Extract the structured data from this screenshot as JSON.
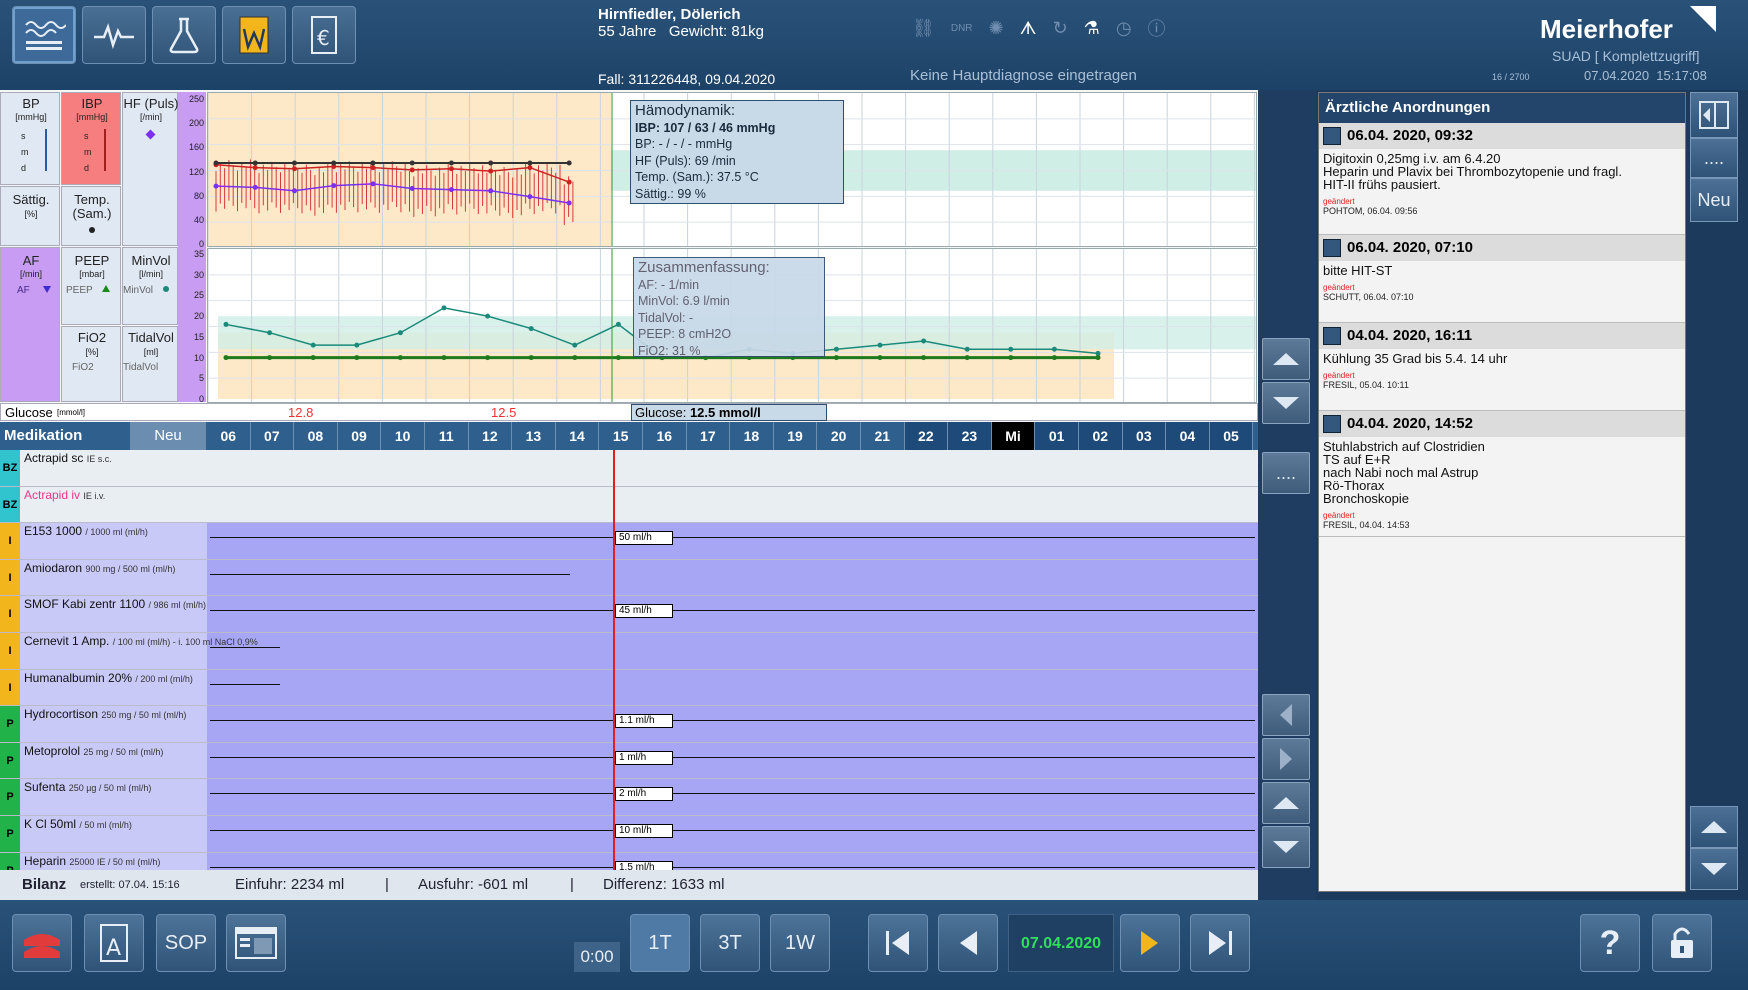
{
  "toolbar": {
    "icons": [
      "monitor-waves-icon",
      "vital-curve-icon",
      "flask-icon",
      "document-w-icon",
      "euro-document-icon"
    ]
  },
  "patient": {
    "name": "Hirnfiedler, Dölerich",
    "age_weight": "55 Jahre   Gewicht: 81kg",
    "case": "Fall: 311226448, 09.04.2020",
    "diagnosis": "Keine Hauptdiagnose eingetragen"
  },
  "header_icons": [
    "link-icon",
    "dnr-icon",
    "virus-icon",
    "lungs-icon",
    "refresh-icon",
    "lab-flask-icon",
    "clock-icon",
    "info-icon"
  ],
  "header_dnr": "DNR",
  "brand": {
    "name": "Meierhofer",
    "access": "SUAD [ Komplettzugriff]",
    "counter": "16 / 2700",
    "datetime": "07.04.2020  15:17:08"
  },
  "vitals_params": {
    "bp": {
      "label": "BP",
      "unit": "[mmHg]",
      "s": "s",
      "m": "m",
      "d": "d"
    },
    "ibp": {
      "label": "IBP",
      "unit": "[mmHg]",
      "s": "s",
      "m": "m",
      "d": "d"
    },
    "hf": {
      "label": "HF (Puls)",
      "unit": "[/min]"
    },
    "sattig": {
      "label": "Sättig.",
      "unit": "[%]"
    },
    "temp": {
      "label": "Temp.",
      "unit": "(Sam.)"
    },
    "af": {
      "label": "AF",
      "unit": "[/min]",
      "legend": "AF"
    },
    "peep": {
      "label": "PEEP",
      "unit": "[mbar]",
      "legend": "PEEP"
    },
    "minvol": {
      "label": "MinVol",
      "unit": "[l/min]",
      "legend": "MinVol"
    },
    "fio2": {
      "label": "FiO2",
      "unit": "[%]",
      "legend": "FiO2"
    },
    "tidalvol": {
      "label": "TidalVol",
      "unit": "[ml]",
      "legend": "TidalVol"
    }
  },
  "axis1": [
    "250",
    "200",
    "160",
    "120",
    "80",
    "40",
    "0"
  ],
  "axis2": [
    "35",
    "30",
    "25",
    "20",
    "15",
    "10",
    "5",
    "0"
  ],
  "hemodynamik": {
    "title": "Hämodynamik:",
    "ibp": "IBP: 107 / 63 / 46 mmHg",
    "bp": "BP: - / - / - mmHg",
    "hf": "HF (Puls): 69 /min",
    "temp": "Temp. (Sam.): 37.5 °C",
    "sattig": "Sättig.: 99 %"
  },
  "zusammenfassung": {
    "title": "Zusammenfassung:",
    "af": "AF: - 1/min",
    "minvol": "MinVol: 6.9 l/min",
    "tidalvol": "TidalVol: -",
    "peep": "PEEP: 8 cmH2O",
    "fio2": "FiO2: 31 %"
  },
  "glucose": {
    "label": "Glucose",
    "unit": "[mmol/l]",
    "v1": "12.8",
    "v2": "12.5",
    "current_label": "Glucose:",
    "current_value": "12.5 mmol/l"
  },
  "medikation": {
    "label": "Medikation",
    "neu": "Neu",
    "hours": [
      "06",
      "07",
      "08",
      "09",
      "10",
      "11",
      "12",
      "13",
      "14",
      "15",
      "16",
      "17",
      "18",
      "19",
      "20",
      "21",
      "22",
      "23",
      "Mi",
      "01",
      "02",
      "03",
      "04",
      "05"
    ],
    "rows": [
      {
        "cat": "BZ",
        "name": "Actrapid sc",
        "detail": "IE s.c."
      },
      {
        "cat": "BZ",
        "name": "Actrapid iv",
        "detail": "IE i.v."
      },
      {
        "cat": "I",
        "name": "E153 1000",
        "detail": "/ 1000 ml (ml/h)",
        "rate": "50 ml/h"
      },
      {
        "cat": "I",
        "name": "Amiodaron",
        "detail": "900 mg / 500 ml (ml/h)"
      },
      {
        "cat": "I",
        "name": "SMOF Kabi zentr 1100",
        "detail": "/ 986 ml (ml/h)",
        "rate": "45 ml/h"
      },
      {
        "cat": "I",
        "name": "Cernevit 1 Amp.",
        "detail": "/ 100 ml (ml/h) - i. 100 ml NaCl 0,9%"
      },
      {
        "cat": "I",
        "name": "Humanalbumin 20%",
        "detail": "/ 200 ml (ml/h)"
      },
      {
        "cat": "P",
        "name": "Hydrocortison",
        "detail": "250 mg / 50 ml (ml/h)",
        "rate": "1.1 ml/h"
      },
      {
        "cat": "P",
        "name": "Metoprolol",
        "detail": "25 mg / 50 ml (ml/h)",
        "rate": "1 ml/h"
      },
      {
        "cat": "P",
        "name": "Sufenta",
        "detail": "250 µg / 50 ml (ml/h)",
        "rate": "2 ml/h"
      },
      {
        "cat": "P",
        "name": "K Cl 50ml",
        "detail": "/ 50 ml (ml/h)",
        "rate": "10 ml/h"
      },
      {
        "cat": "P",
        "name": "Heparin",
        "detail": "25000 IE / 50 ml (ml/h)",
        "rate": "1.5 ml/h"
      }
    ]
  },
  "bilanz": {
    "label": "Bilanz",
    "created": "erstellt: 07.04. 15:16",
    "einfuhr": "Einfuhr: 2234 ml",
    "ausfuhr": "Ausfuhr: -601 ml",
    "differenz": "Differenz: 1633 ml",
    "sep": "|"
  },
  "side": {
    "more": "....",
    "neu": "Neu"
  },
  "orders": {
    "title": "Ärztliche Anordnungen",
    "items": [
      {
        "date": "06.04. 2020, 09:32",
        "text": "Digitoxin 0,25mg i.v. am 6.4.20\nHeparin und Plavix bei Thrombozytopenie und fragl.\nHIT-II frühs pausiert.",
        "changed": "geändert",
        "by": "POHTOM, 06.04. 09:56"
      },
      {
        "date": "06.04. 2020, 07:10",
        "text": "bitte HIT-ST",
        "changed": "geändert",
        "by": "SCHUTT, 06.04. 07:10"
      },
      {
        "date": "04.04. 2020, 16:11",
        "text": "Kühlung 35 Grad bis 5.4. 14 uhr",
        "changed": "geändert",
        "by": "FRESIL, 05.04. 10:11"
      },
      {
        "date": "04.04. 2020, 14:52",
        "text": "Stuhlabstrich auf Clostridien\nTS auf E+R\nnach Nabi noch mal Astrup\nRö-Thorax\nBronchoskopie",
        "changed": "geändert",
        "by": "FRESIL, 04.04. 14:53"
      }
    ]
  },
  "bottom": {
    "sop": "SOP",
    "time": "0:00",
    "t1": "1T",
    "t3": "3T",
    "w1": "1W",
    "date": "07.04.2020"
  },
  "colors": {
    "accent_yellow": "#f2b61c",
    "bp_pink": "#f77e7e",
    "resp_purple": "#c79cf2",
    "infusion": "#a6a6f5",
    "green_date": "#2ee05a"
  },
  "chart_data": [
    {
      "type": "line",
      "title": "",
      "x": [
        "06",
        "07",
        "08",
        "09",
        "10",
        "11",
        "12",
        "13",
        "14",
        "15"
      ],
      "ylim": [
        0,
        250
      ],
      "series": [
        {
          "name": "IBP",
          "values": [
            135,
            130,
            128,
            132,
            130,
            126,
            128,
            124,
            130,
            105
          ]
        },
        {
          "name": "HF (Puls)",
          "values": [
            98,
            96,
            90,
            99,
            102,
            94,
            92,
            90,
            80,
            69
          ]
        },
        {
          "name": "Temp. (Sam.)",
          "values": [
            138,
            138,
            138,
            138,
            138,
            138,
            138,
            138,
            138,
            138
          ]
        }
      ]
    },
    {
      "type": "line",
      "title": "",
      "x": [
        "06",
        "07",
        "08",
        "09",
        "10",
        "11",
        "12",
        "13",
        "14",
        "15",
        "16",
        "17",
        "18",
        "19",
        "20",
        "21",
        "22",
        "23",
        "Mi",
        "01",
        "02"
      ],
      "ylim": [
        0,
        35
      ],
      "series": [
        {
          "name": "MinVol",
          "values": [
            18,
            16,
            13,
            13,
            16,
            22,
            20,
            17,
            13,
            18,
            10,
            10,
            12,
            11,
            12,
            13,
            14,
            12,
            12,
            12,
            11
          ]
        },
        {
          "name": "PEEP",
          "values": [
            10,
            10,
            10,
            10,
            10,
            10,
            10,
            10,
            10,
            10,
            10,
            10,
            10,
            10,
            10,
            10,
            10,
            10,
            10,
            10,
            10
          ]
        }
      ]
    }
  ]
}
